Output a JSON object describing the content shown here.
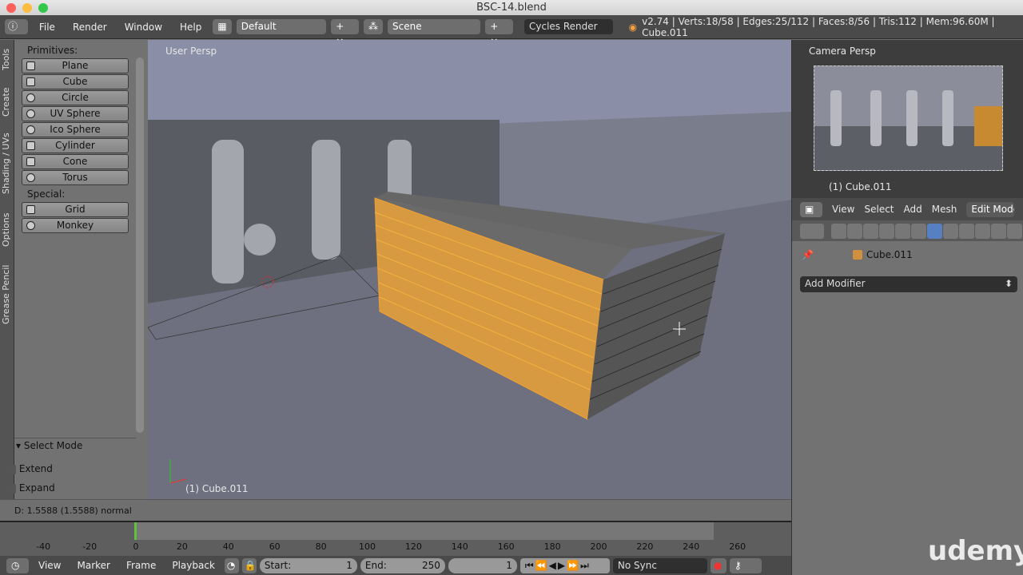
{
  "window": {
    "title": "BSC-14.blend"
  },
  "topbar": {
    "menus": [
      "File",
      "Render",
      "Window",
      "Help"
    ],
    "layout": "Default",
    "scene": "Scene",
    "engine": "Cycles Render",
    "stats": "v2.74 | Verts:18/58 | Edges:25/112 | Faces:8/56 | Tris:112 | Mem:96.60M | Cube.011"
  },
  "tabs": [
    "Tools",
    "Create",
    "Shading / UVs",
    "Options",
    "Grease Pencil"
  ],
  "tools": {
    "primitives_label": "Primitives:",
    "primitives": [
      "Plane",
      "Cube",
      "Circle",
      "UV Sphere",
      "Ico Sphere",
      "Cylinder",
      "Cone",
      "Torus"
    ],
    "special_label": "Special:",
    "special": [
      "Grid",
      "Monkey"
    ],
    "select_mode": {
      "title": "Select Mode",
      "options": [
        {
          "label": "Extend",
          "checked": false
        },
        {
          "label": "Expand",
          "checked": false
        }
      ]
    }
  },
  "viewport": {
    "view_name": "User Persp",
    "object_label": "(1) Cube.011",
    "selected_color": "#f0a030"
  },
  "status": {
    "text": "D: 1.5588 (1.5588) normal"
  },
  "timeline": {
    "ticks": [
      "-40",
      "-20",
      "0",
      "20",
      "40",
      "60",
      "80",
      "100",
      "120",
      "140",
      "160",
      "180",
      "200",
      "220",
      "240",
      "260"
    ],
    "current_frame_marker": 0,
    "header": {
      "menus": [
        "View",
        "Marker",
        "Frame",
        "Playback"
      ],
      "start_label": "Start:",
      "start": "1",
      "end_label": "End:",
      "end": "250",
      "current": "1",
      "sync": "No Sync"
    }
  },
  "camera": {
    "view_name": "Camera Persp",
    "object_label": "(1) Cube.011"
  },
  "properties": {
    "menus": [
      "View",
      "Select",
      "Add",
      "Mesh"
    ],
    "mode": "Edit Mode",
    "object": "Cube.011",
    "add_modifier": "Add Modifier",
    "active_tab": "modifiers"
  },
  "watermark": "udemy"
}
